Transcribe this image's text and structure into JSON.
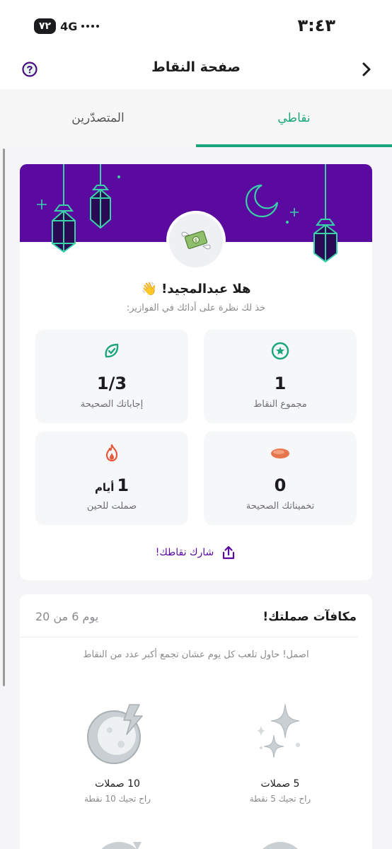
{
  "status_bar": {
    "time": "٣:٤٣",
    "battery": "٧٢",
    "network": "4G"
  },
  "header": {
    "title": "صفحة النقاط"
  },
  "tabs": [
    {
      "label": "نقاطي",
      "active": true
    },
    {
      "label": "المتصدّرين",
      "active": false
    }
  ],
  "profile": {
    "greeting": "هلا عبدالمجيد! 👋",
    "subtitle": "خذ لك نظرة على أدائك في الفوازير:"
  },
  "stats": {
    "total_points": {
      "value": "1",
      "label": "مجموع النقاط",
      "icon": "star-badge-icon"
    },
    "correct_answers": {
      "value": "1/3",
      "label": "إجاباتك الصحيحة",
      "icon": "leaf-check-icon"
    },
    "correct_guesses": {
      "value": "0",
      "label": "تخميناتك الصحيحة",
      "icon": "date-icon"
    },
    "streak": {
      "value": "1",
      "unit": "أيام",
      "label": "صملت للحين",
      "icon": "flame-icon"
    }
  },
  "share": {
    "label": "شارك نقاطك!",
    "icon": "share-icon"
  },
  "rewards": {
    "title": "مكافآت صملتك!",
    "day_progress": "يوم 6 من 20",
    "hint": "اصمل! حاول تلعب كل يوم عشان تجمع أكبر عدد من النقاط",
    "items": [
      {
        "title": "5 صملات",
        "subtitle": "راح تجيك 5 نقطة",
        "icon": "sparkles-icon"
      },
      {
        "title": "10 صملات",
        "subtitle": "راح تجيك 10 نقطة",
        "icon": "moon-bolt-icon"
      }
    ]
  },
  "colors": {
    "accent": "#1aa57a",
    "brand_purple": "#5a0a9e",
    "flame": "#e8583a"
  }
}
